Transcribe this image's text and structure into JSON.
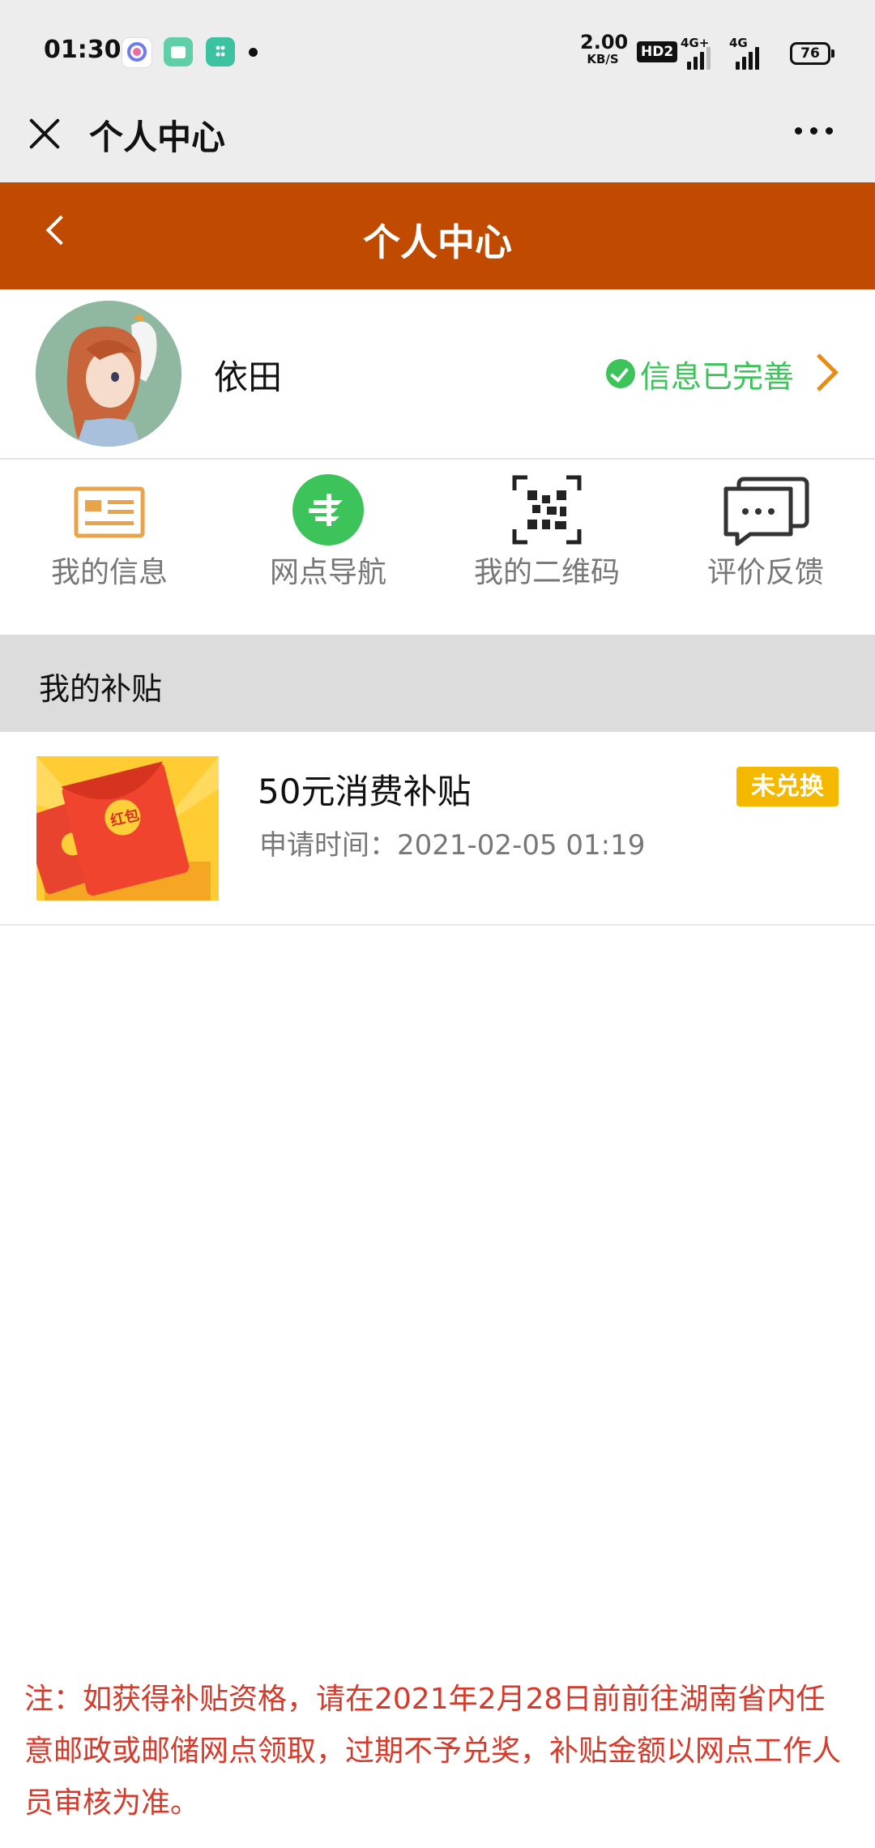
{
  "status_bar": {
    "time": "01:30",
    "net_speed_value": "2.00",
    "net_speed_unit": "KB/S",
    "hd_label": "HD2",
    "signal1_label": "4G+",
    "signal2_label": "4G",
    "battery": "76",
    "app_icons": [
      "qq-icon",
      "gallery-icon",
      "cleaner-icon"
    ]
  },
  "title_bar": {
    "title": "个人中心"
  },
  "header": {
    "title": "个人中心"
  },
  "profile": {
    "name": "依田",
    "status": "信息已完善"
  },
  "menu": {
    "items": [
      {
        "label": "我的信息",
        "icon": "id-card-icon"
      },
      {
        "label": "网点导航",
        "icon": "post-logo-icon"
      },
      {
        "label": "我的二维码",
        "icon": "qr-code-icon"
      },
      {
        "label": "评价反馈",
        "icon": "chat-bubble-icon"
      }
    ]
  },
  "subsidy_section": {
    "title": "我的补贴",
    "items": [
      {
        "name": "50元消费补贴",
        "time": "申请时间：2021-02-05 01:19",
        "badge": "未兑换",
        "thumb_label": "红包"
      }
    ]
  },
  "note": "注：如获得补贴资格，请在2021年2月28日前前往湖南省内任意邮政或邮储网点领取，过期不予兑奖，补贴金额以网点工作人员审核为准。",
  "colors": {
    "header_orange": "#c04a00",
    "verified_green": "#3cc35a",
    "badge_yellow": "#f5b800",
    "note_red": "#d63a2a"
  }
}
